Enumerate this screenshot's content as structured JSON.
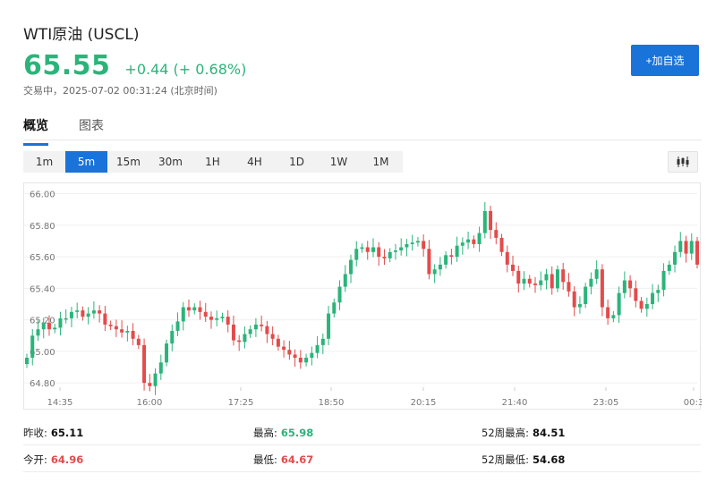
{
  "header": {
    "title": "WTI原油 (USCL)",
    "price": "65.55",
    "change": "+0.44 (+ 0.68%)",
    "status": "交易中，2025-07-02 00:31:24 (北京时间)",
    "add_label": "+加自选"
  },
  "tabs": [
    {
      "label": "概览",
      "active": true
    },
    {
      "label": "图表",
      "active": false
    }
  ],
  "periods": [
    {
      "label": "1m",
      "active": false
    },
    {
      "label": "5m",
      "active": true
    },
    {
      "label": "15m",
      "active": false
    },
    {
      "label": "30m",
      "active": false
    },
    {
      "label": "1H",
      "active": false
    },
    {
      "label": "4H",
      "active": false
    },
    {
      "label": "1D",
      "active": false
    },
    {
      "label": "1W",
      "active": false
    },
    {
      "label": "1M",
      "active": false
    }
  ],
  "icons": {
    "chart_type": "candlestick-icon"
  },
  "colors": {
    "up": "#2bb47a",
    "down": "#e34b4b",
    "accent": "#1a73d9"
  },
  "stats": {
    "prev_close": {
      "label": "昨收:",
      "value": "65.11"
    },
    "high": {
      "label": "最高:",
      "value": "65.98"
    },
    "high_52w": {
      "label": "52周最高:",
      "value": "84.51"
    },
    "open": {
      "label": "今开:",
      "value": "64.96"
    },
    "low": {
      "label": "最低:",
      "value": "64.67"
    },
    "low_52w": {
      "label": "52周最低:",
      "value": "54.68"
    }
  },
  "chart_data": {
    "type": "candlestick",
    "ylim": [
      64.75,
      66.02
    ],
    "y_ticks": [
      "66.00",
      "65.80",
      "65.60",
      "65.40",
      "65.20",
      "65.00",
      "64.80"
    ],
    "x_ticks": [
      "14:35",
      "16:00",
      "17:25",
      "18:50",
      "20:15",
      "21:40",
      "23:05",
      "00:3"
    ],
    "close_series": [
      64.96,
      65.1,
      65.14,
      65.18,
      65.14,
      65.15,
      65.21,
      65.21,
      65.25,
      65.26,
      65.22,
      65.24,
      65.26,
      65.24,
      65.17,
      65.16,
      65.14,
      65.12,
      65.13,
      65.08,
      65.04,
      64.8,
      64.78,
      64.86,
      64.93,
      65.05,
      65.13,
      65.19,
      65.28,
      65.26,
      65.28,
      65.25,
      65.22,
      65.2,
      65.21,
      65.22,
      65.17,
      65.07,
      65.06,
      65.11,
      65.14,
      65.17,
      65.16,
      65.11,
      65.08,
      65.03,
      65.01,
      64.98,
      64.96,
      64.93,
      64.96,
      64.99,
      65.04,
      65.08,
      65.24,
      65.31,
      65.41,
      65.49,
      65.58,
      65.65,
      65.66,
      65.63,
      65.66,
      65.6,
      65.59,
      65.63,
      65.64,
      65.66,
      65.68,
      65.69,
      65.7,
      65.65,
      65.49,
      65.52,
      65.55,
      65.61,
      65.6,
      65.67,
      65.69,
      65.71,
      65.68,
      65.75,
      65.89,
      65.77,
      65.72,
      65.63,
      65.55,
      65.51,
      65.43,
      65.46,
      65.43,
      65.42,
      65.45,
      65.49,
      65.4,
      65.52,
      65.44,
      65.38,
      65.28,
      65.3,
      65.41,
      65.46,
      65.52,
      65.28,
      65.21,
      65.23,
      65.37,
      65.45,
      65.4,
      65.32,
      65.27,
      65.3,
      65.37,
      65.39,
      65.51,
      65.55,
      65.63,
      65.7,
      65.62,
      65.7,
      65.55
    ]
  }
}
